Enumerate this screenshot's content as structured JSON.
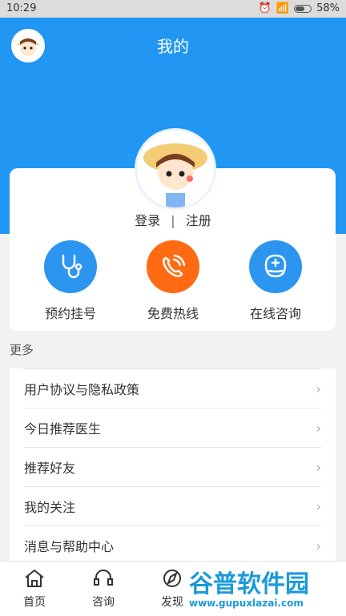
{
  "status": {
    "time": "10:29",
    "battery": "58%"
  },
  "header": {
    "title": "我的"
  },
  "auth": {
    "login": "登录",
    "separator": "|",
    "register": "注册"
  },
  "quick_actions": [
    {
      "label": "预约挂号",
      "color": "#2b95f0",
      "icon": "stethoscope-icon"
    },
    {
      "label": "免费热线",
      "color": "#ff6a13",
      "icon": "phone-icon"
    },
    {
      "label": "在线咨询",
      "color": "#2b95f0",
      "icon": "doctor-icon"
    }
  ],
  "more": {
    "title": "更多",
    "items": [
      "用户协议与隐私政策",
      "今日推荐医生",
      "推荐好友",
      "我的关注",
      "消息与帮助中心"
    ]
  },
  "tabs": [
    {
      "label": "首页",
      "icon": "home-icon"
    },
    {
      "label": "咨询",
      "icon": "headset-icon"
    },
    {
      "label": "发现",
      "icon": "compass-icon"
    }
  ],
  "watermark": {
    "text1": "谷普软件园",
    "text2": "www.gupuxlazai.com"
  }
}
